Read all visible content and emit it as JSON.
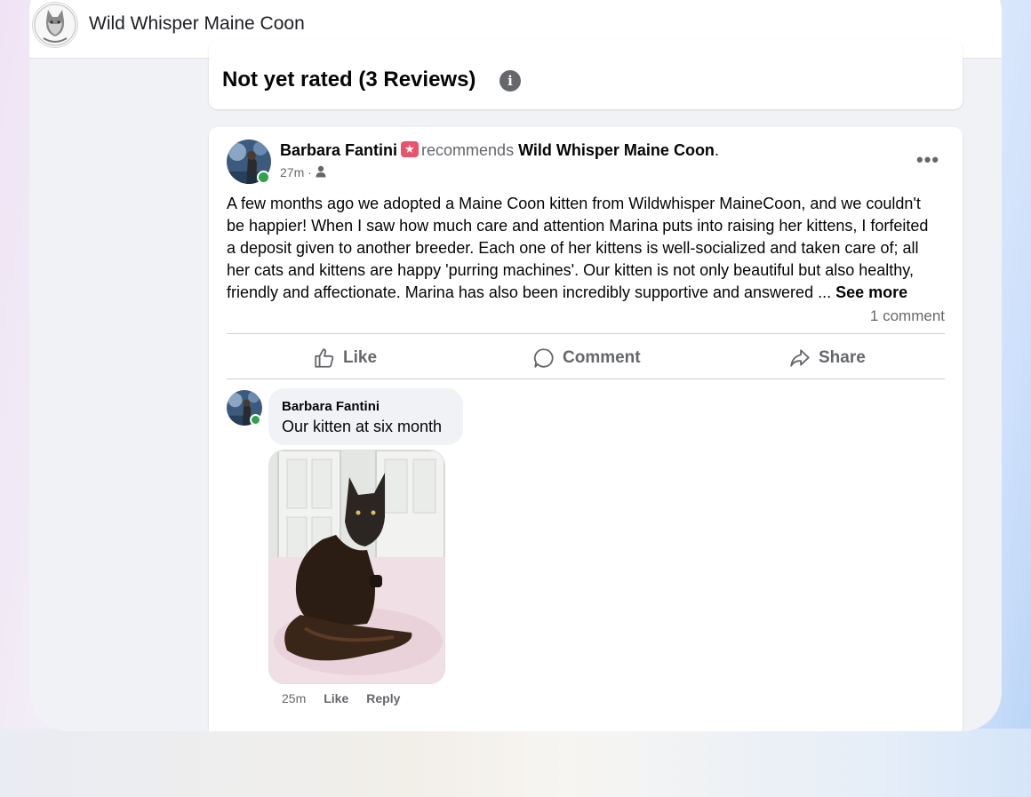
{
  "page": {
    "title": "Wild Whisper Maine Coon"
  },
  "rating": {
    "title": "Not yet rated (3 Reviews)",
    "info_icon": "i"
  },
  "post": {
    "author": "Barbara Fantini",
    "verb": "recommends",
    "target": "Wild Whisper Maine Coon",
    "target_suffix": ".",
    "time": "27m",
    "audience_icon": "friends-icon",
    "more_icon": "•••",
    "body": "A few months ago we adopted a Maine Coon kitten from Wildwhisper MaineCoon, and we couldn't be happier! When I saw how much care and attention Marina puts into raising her kittens, I forfeited a deposit given to another breeder. Each one of her kittens is well-socialized and taken care of; all her cats and kittens are happy 'purring machines'. Our kitten is not only beautiful but also healthy, friendly and affectionate. Marina has also been incredibly supportive and answered ... ",
    "see_more": "See more",
    "comment_count": "1 comment"
  },
  "actions": {
    "like": "Like",
    "comment": "Comment",
    "share": "Share"
  },
  "comment": {
    "author": "Barbara Fantini",
    "text": "Our kitten at six month",
    "time": "25m",
    "like": "Like",
    "reply": "Reply"
  },
  "colors": {
    "secondary_text": "#65676b",
    "online": "#31a24c",
    "recommend_badge": "#e8546b"
  }
}
